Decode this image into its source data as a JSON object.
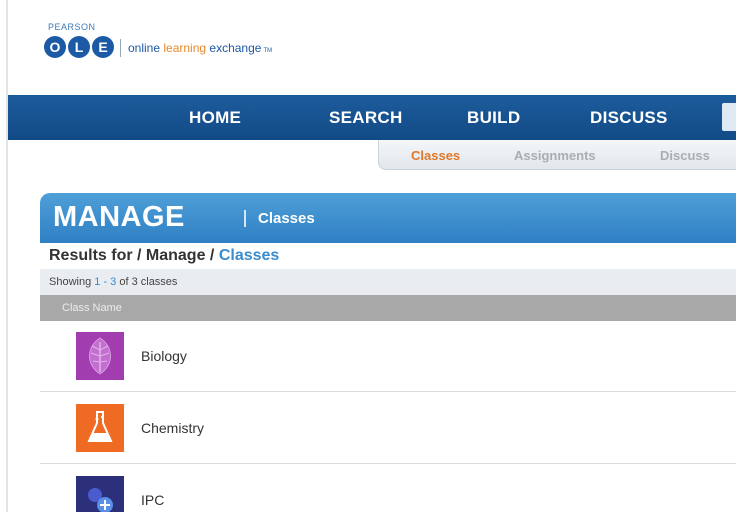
{
  "logo": {
    "brand": "PEARSON",
    "letters": [
      "O",
      "L",
      "E"
    ],
    "tagline_part1": "online ",
    "tagline_part2": "learning",
    "tagline_part3": " exchange",
    "trademark": "TM"
  },
  "topnav": {
    "items": [
      "HOME",
      "SEARCH",
      "BUILD",
      "DISCUSS"
    ]
  },
  "subnav": {
    "items": [
      "Classes",
      "Assignments",
      "Discuss"
    ],
    "active": "Classes"
  },
  "manage": {
    "title": "MANAGE",
    "subtitle": "Classes"
  },
  "results": {
    "prefix": "Results for / Manage / ",
    "current": "Classes"
  },
  "showing": {
    "label": "Showing",
    "range": "1 - 3",
    "suffix": "of 3 classes"
  },
  "table": {
    "column_header": "Class Name",
    "rows": [
      {
        "name": "Biology",
        "icon": "leaf-icon",
        "color": "#a23db0"
      },
      {
        "name": "Chemistry",
        "icon": "beaker-icon",
        "color": "#ef6a23"
      },
      {
        "name": "IPC",
        "icon": "molecule-icon",
        "color": "#2c2f7a"
      }
    ]
  },
  "colors": {
    "nav_blue": "#1d5c9c",
    "manage_blue": "#3a8ccc",
    "accent_orange": "#e58a2c",
    "link_blue": "#3a8ccc"
  }
}
